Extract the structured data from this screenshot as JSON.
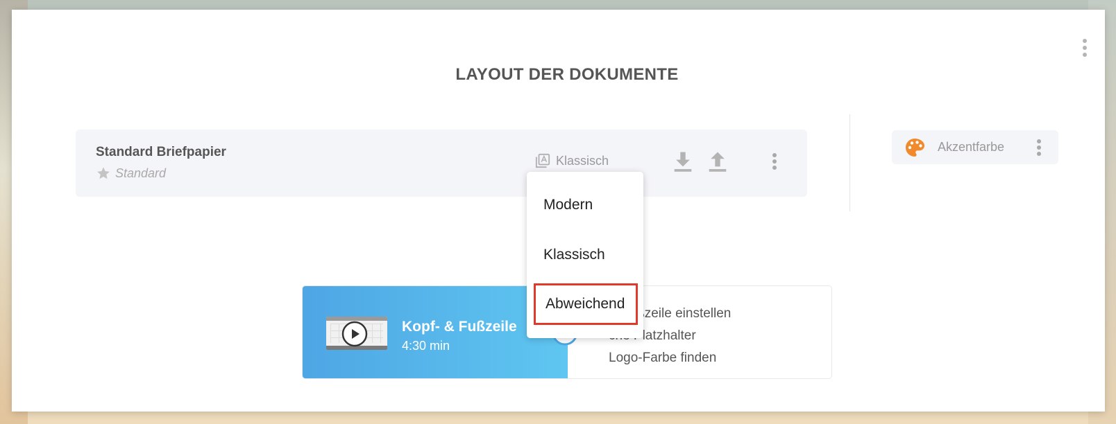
{
  "page": {
    "title": "LAYOUT DER DOKUMENTE"
  },
  "layout_row": {
    "name": "Standard Briefpapier",
    "subtitle": "Standard",
    "style_value": "Klassisch",
    "icons": [
      "star-icon",
      "layout-icon",
      "download-icon",
      "upload-icon",
      "more-vertical-icon"
    ]
  },
  "accent": {
    "label": "Akzentfarbe",
    "icon": "palette-icon",
    "icon_color": "#f08a2c"
  },
  "dropdown": {
    "options": [
      "Modern",
      "Klassisch",
      "Abweichend"
    ],
    "highlighted": "Abweichend",
    "highlight_color": "#e03a2b"
  },
  "video": {
    "title": "Kopf- & Fußzeile",
    "duration": "4:30 min",
    "topics": [
      "& Fußzeile einstellen",
      "che Platzhalter",
      "Logo-Farbe finden"
    ]
  },
  "colors": {
    "card_background": "#ffffff",
    "row_background": "#f4f5f8",
    "video_gradient_start": "#4ea6e4",
    "video_gradient_end": "#5fc6f1"
  }
}
